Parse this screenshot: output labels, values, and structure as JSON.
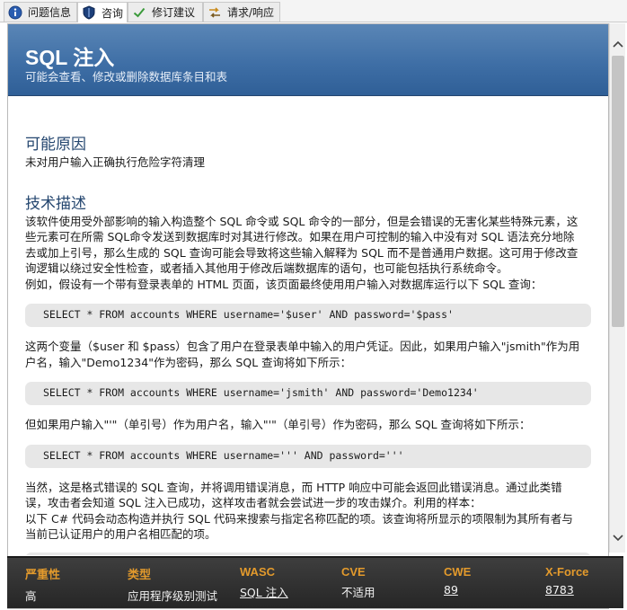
{
  "tabs": [
    {
      "label": "问题信息",
      "icon": "info-icon"
    },
    {
      "label": "咨询",
      "icon": "shield-icon"
    },
    {
      "label": "修订建议",
      "icon": "checkmark-icon"
    },
    {
      "label": "请求/响应",
      "icon": "exchange-arrows-icon"
    }
  ],
  "active_tab": "咨询",
  "banner": {
    "title": "SQL 注入",
    "subtitle": "可能会查看、修改或删除数据库条目和表"
  },
  "cause": {
    "heading": "可能原因",
    "text": "未对用户输入正确执行危险字符清理"
  },
  "technical": {
    "heading": "技术描述",
    "para1_line1": "该软件使用受外部影响的输入构造整个 SQL 命令或 SQL 命令的一部分，但是会错误的无害化某些特殊元素，这",
    "para1_line2": "些元素可在所需 SQL命令发送到数据库时对其进行修改。如果在用户可控制的输入中没有对 SQL 语法充分地除",
    "para1_line3": "去或加上引号，那么生成的 SQL 查询可能会导致将这些输入解释为 SQL 而不是普通用户数据。这可用于修改查",
    "para1_line4": "询逻辑以绕过安全性检查，或者插入其他用于修改后端数据库的语句，也可能包括执行系统命令。",
    "para1_line5": "例如，假设有一个带有登录表单的 HTML 页面，该页面最终使用用户输入对数据库运行以下 SQL 查询：",
    "code1": "SELECT * FROM accounts WHERE username='$user' AND password='$pass'",
    "para2_line1": "这两个变量（$user 和 $pass）包含了用户在登录表单中输入的用户凭证。因此，如果用户输入\"jsmith\"作为用",
    "para2_line2": "户名，输入\"Demo1234\"作为密码，那么 SQL 查询将如下所示：",
    "code2": "SELECT * FROM accounts WHERE username='jsmith' AND password='Demo1234'",
    "para3": "但如果用户输入\"'\"（单引号）作为用户名，输入\"'\"（单引号）作为密码，那么 SQL 查询将如下所示：",
    "code3": "SELECT * FROM accounts WHERE username=''' AND password='''",
    "para4_line1": "当然，这是格式错误的 SQL 查询，并将调用错误消息，而 HTTP 响应中可能会返回此错误消息。通过此类错",
    "para4_line2": "误，攻击者会知道 SQL 注入已成功，这样攻击者就会尝试进一步的攻击媒介。利用的样本：",
    "para4_line3": "以下 C# 代码会动态构造并执行 SQL 代码来搜索与指定名称匹配的项。该查询将所显示的项限制为其所有者与",
    "para4_line4": "当前已认证用户的用户名相匹配的项。"
  },
  "summary": [
    {
      "label": "严重性",
      "value": "高",
      "link": false
    },
    {
      "label": "类型",
      "value": "应用程序级别测试",
      "link": false
    },
    {
      "label": "WASC",
      "value": "SQL 注入",
      "link": true
    },
    {
      "label": "CVE",
      "value": "不适用",
      "link": false
    },
    {
      "label": "CWE",
      "value": "89",
      "link": true
    },
    {
      "label": "X-Force",
      "value": "8783",
      "link": true
    }
  ],
  "colors": {
    "banner": "#3f6fa6",
    "heading": "#24466f",
    "summary_label": "#e39a2c",
    "summary_bg": "#2e2e2e"
  }
}
